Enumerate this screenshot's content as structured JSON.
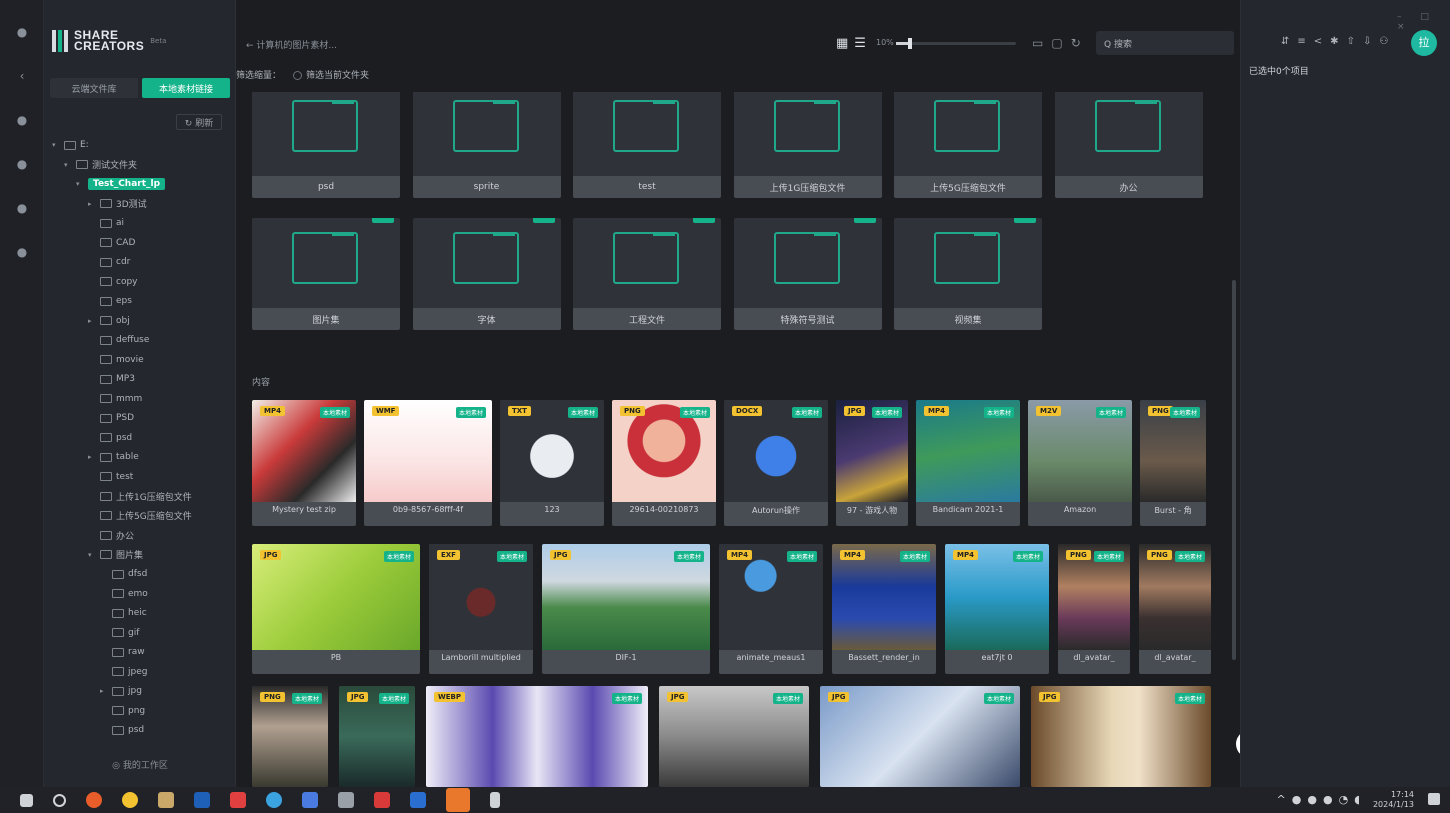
{
  "app": {
    "logo_line1": "SHARE",
    "logo_line2": "CREATORS",
    "logo_sub": "Beta"
  },
  "sidebar": {
    "tabs": [
      {
        "label": "云端文件库"
      },
      {
        "label": "本地素材链接"
      }
    ],
    "refresh_label": "↻ 刷新",
    "workspace_label": "◎ 我的工作区",
    "tree": [
      {
        "label": "E:",
        "depth": 0,
        "caret": "▾"
      },
      {
        "label": "测试文件夹",
        "depth": 1,
        "caret": "▾"
      },
      {
        "label": "Test_Chart_lp",
        "depth": 2,
        "caret": "▾",
        "selected": true
      },
      {
        "label": "3D测试",
        "depth": 3,
        "caret": "▸"
      },
      {
        "label": "ai",
        "depth": 3,
        "caret": ""
      },
      {
        "label": "CAD",
        "depth": 3,
        "caret": ""
      },
      {
        "label": "cdr",
        "depth": 3,
        "caret": ""
      },
      {
        "label": "copy",
        "depth": 3,
        "caret": ""
      },
      {
        "label": "eps",
        "depth": 3,
        "caret": ""
      },
      {
        "label": "obj",
        "depth": 3,
        "caret": "▸"
      },
      {
        "label": "deffuse",
        "depth": 3,
        "caret": ""
      },
      {
        "label": "movie",
        "depth": 3,
        "caret": ""
      },
      {
        "label": "MP3",
        "depth": 3,
        "caret": ""
      },
      {
        "label": "mmm",
        "depth": 3,
        "caret": ""
      },
      {
        "label": "PSD",
        "depth": 3,
        "caret": ""
      },
      {
        "label": "psd",
        "depth": 3,
        "caret": ""
      },
      {
        "label": "table",
        "depth": 3,
        "caret": "▸"
      },
      {
        "label": "test",
        "depth": 3,
        "caret": ""
      },
      {
        "label": "上传1G压缩包文件",
        "depth": 3,
        "caret": ""
      },
      {
        "label": "上传5G压缩包文件",
        "depth": 3,
        "caret": ""
      },
      {
        "label": "办公",
        "depth": 3,
        "caret": ""
      },
      {
        "label": "图片集",
        "depth": 3,
        "caret": "▾"
      },
      {
        "label": "dfsd",
        "depth": 4,
        "caret": ""
      },
      {
        "label": "emo",
        "depth": 4,
        "caret": ""
      },
      {
        "label": "heic",
        "depth": 4,
        "caret": ""
      },
      {
        "label": "gif",
        "depth": 4,
        "caret": ""
      },
      {
        "label": "raw",
        "depth": 4,
        "caret": ""
      },
      {
        "label": "jpeg",
        "depth": 4,
        "caret": ""
      },
      {
        "label": "jpg",
        "depth": 4,
        "caret": "▸"
      },
      {
        "label": "png",
        "depth": 4,
        "caret": ""
      },
      {
        "label": "psd",
        "depth": 4,
        "caret": ""
      }
    ]
  },
  "topbar": {
    "back_label": "← 计算机的图片素材...",
    "zoom_label": "10%",
    "zoom_value": 0.1,
    "search_placeholder": "Q 搜索",
    "filter_label": "筛选缩量：",
    "filter_option": "筛选当前文件夹"
  },
  "main": {
    "section_label": "内容",
    "folders": [
      {
        "label": "psd"
      },
      {
        "label": "sprite"
      },
      {
        "label": "test"
      },
      {
        "label": "上传1G压缩包文件"
      },
      {
        "label": "上传5G压缩包文件"
      },
      {
        "label": "办公"
      },
      {
        "label": "图片集"
      },
      {
        "label": "字体"
      },
      {
        "label": "工程文件"
      },
      {
        "label": "特殊符号测试"
      },
      {
        "label": "视频集"
      }
    ],
    "files_row1": [
      {
        "type": "MP4",
        "name": "Mystery test zip",
        "thumb": "art"
      },
      {
        "type": "WMF",
        "name": "0b9-8567-68fff-4f",
        "thumb": "doc"
      },
      {
        "type": "TXT",
        "name": "123",
        "thumb": "blank"
      },
      {
        "type": "PNG",
        "name": "29614-00210873",
        "thumb": "char"
      },
      {
        "type": "DOCX",
        "name": "Autorun操作",
        "thumb": "docx"
      },
      {
        "type": "JPG",
        "name": "97 - 游戏人物",
        "thumb": "dark"
      },
      {
        "type": "MP4",
        "name": "Bandicam 2021-1",
        "thumb": "island"
      },
      {
        "type": "M2V",
        "name": "Amazon",
        "thumb": "statue"
      },
      {
        "type": "PNG",
        "name": "Burst - 角",
        "thumb": "warrior"
      }
    ],
    "files_row2": [
      {
        "type": "JPG",
        "name": "PB",
        "thumb": "green"
      },
      {
        "type": "EXF",
        "name": "Lamborill multiplied",
        "thumb": "bike"
      },
      {
        "type": "JPG",
        "name": "DIF-1",
        "thumb": "mountain"
      },
      {
        "type": "MP4",
        "name": "animate_meaus1",
        "thumb": "balloon"
      },
      {
        "type": "MP4",
        "name": "Bassett_render_in",
        "thumb": "cushion"
      },
      {
        "type": "MP4",
        "name": "eat7jt 0",
        "thumb": "sea"
      },
      {
        "type": "PNG",
        "name": "dl_avatar_",
        "thumb": "woman"
      },
      {
        "type": "PNG",
        "name": "dl_avatar_",
        "thumb": "woman2"
      }
    ],
    "files_row3": [
      {
        "type": "PNG",
        "thumb": "soldier"
      },
      {
        "type": "JPG",
        "thumb": "ninja"
      },
      {
        "type": "WEBP",
        "thumb": "anime"
      },
      {
        "type": "JPG",
        "thumb": "car"
      },
      {
        "type": "JPG",
        "thumb": "dragon"
      },
      {
        "type": "JPG",
        "thumb": "blonde"
      }
    ],
    "tag_label": "本地素材"
  },
  "right": {
    "selected_label": "已选中0个项目",
    "avatar_initial": "拉"
  },
  "taskbar": {
    "time": "17:14",
    "date": "2024/1/13"
  }
}
